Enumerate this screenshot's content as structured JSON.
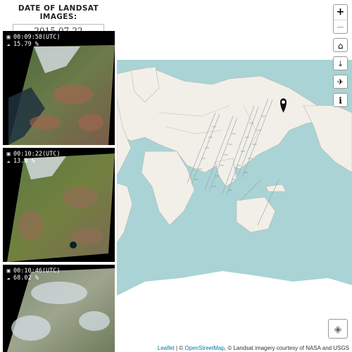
{
  "sidebar": {
    "header": "DATE OF LANDSAT IMAGES:",
    "date_value": "2015-07-22",
    "scenes": [
      {
        "time": "00:09:58(UTC)",
        "cloud": "15.79 %",
        "clock_icon": "calendar-icon",
        "cloud_icon": "cloud-icon"
      },
      {
        "time": "00:10:22(UTC)",
        "cloud": "13.8 %",
        "clock_icon": "calendar-icon",
        "cloud_icon": "cloud-icon"
      },
      {
        "time": "00:10:46(UTC)",
        "cloud": "68.02 %",
        "clock_icon": "calendar-icon",
        "cloud_icon": "cloud-icon"
      }
    ]
  },
  "map": {
    "controls": {
      "zoom_in": "+",
      "zoom_out": "−",
      "home_icon": "home-icon",
      "download_icon": "download-icon",
      "twitter_icon": "twitter-icon",
      "info_icon": "info-icon",
      "layers_icon": "layers-icon"
    },
    "attribution": {
      "leaflet": "Leaflet",
      "sep1": " | © ",
      "osm": "OpenStreetMap",
      "rest": ", © Landsat imagery courtesy of NASA and USGS"
    },
    "colors": {
      "ocean": "#a9d3d5",
      "land": "#f2efe9",
      "ice": "#ffffff"
    }
  }
}
